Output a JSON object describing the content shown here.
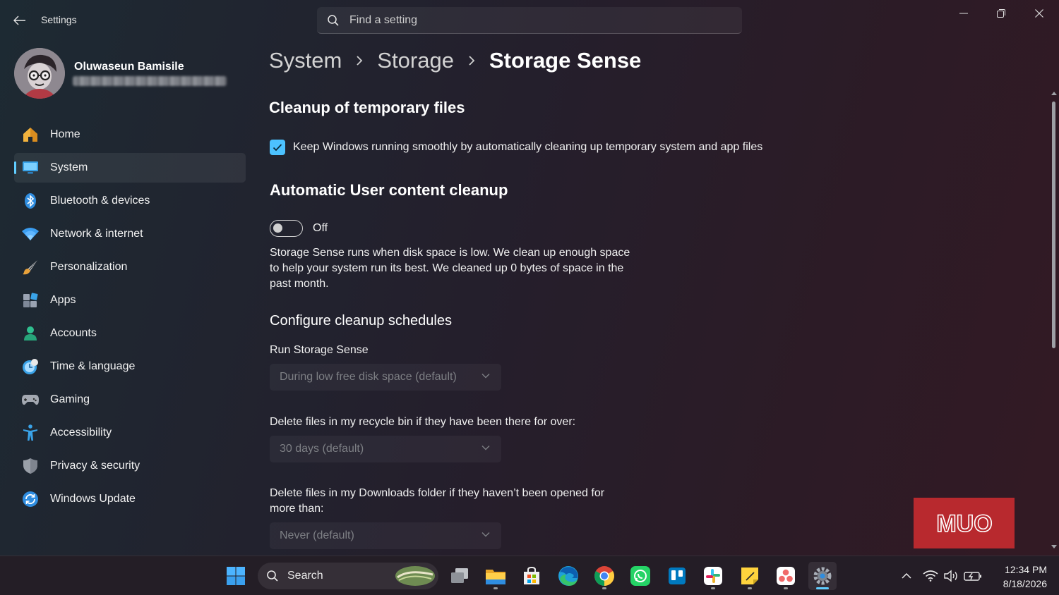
{
  "window": {
    "app_title": "Settings",
    "search_placeholder": "Find a setting"
  },
  "profile": {
    "name": "Oluwaseun Bamisile"
  },
  "nav": {
    "items": [
      {
        "label": "Home",
        "icon": "home-icon"
      },
      {
        "label": "System",
        "icon": "system-icon",
        "active": true
      },
      {
        "label": "Bluetooth & devices",
        "icon": "bluetooth-icon"
      },
      {
        "label": "Network & internet",
        "icon": "wifi-icon"
      },
      {
        "label": "Personalization",
        "icon": "brush-icon"
      },
      {
        "label": "Apps",
        "icon": "apps-icon"
      },
      {
        "label": "Accounts",
        "icon": "accounts-icon"
      },
      {
        "label": "Time & language",
        "icon": "clock-icon"
      },
      {
        "label": "Gaming",
        "icon": "gamepad-icon"
      },
      {
        "label": "Accessibility",
        "icon": "accessibility-icon"
      },
      {
        "label": "Privacy & security",
        "icon": "shield-icon"
      },
      {
        "label": "Windows Update",
        "icon": "update-icon"
      }
    ]
  },
  "breadcrumb": {
    "items": [
      "System",
      "Storage",
      "Storage Sense"
    ]
  },
  "main": {
    "cleanup_heading": "Cleanup of temporary files",
    "cleanup_checkbox_label": "Keep Windows running smoothly by automatically cleaning up temporary system and app files",
    "cleanup_checked": true,
    "auto_heading": "Automatic User content cleanup",
    "toggle_state": "Off",
    "description_lines": [
      "Storage Sense runs when disk space is low. We clean up enough space",
      "to help your system run its best. We cleaned up 0 bytes of space in the",
      "past month."
    ],
    "schedules_heading": "Configure cleanup schedules",
    "run_label": "Run Storage Sense",
    "run_value": "During low free disk space (default)",
    "recycle_label": "Delete files in my recycle bin if they have been there for over:",
    "recycle_value": "30 days (default)",
    "downloads_label_lines": [
      "Delete files in my Downloads folder if they haven’t been opened for",
      "more than:"
    ],
    "downloads_value": "Never (default)"
  },
  "watermark": {
    "text": "MUO"
  },
  "taskbar": {
    "search_label": "Search",
    "apps": [
      "start-icon",
      "task-view-icon",
      "file-explorer-icon",
      "store-icon",
      "edge-icon",
      "chrome-icon",
      "whatsapp-icon",
      "trello-icon",
      "slack-icon",
      "sticky-notes-icon",
      "asana-icon",
      "settings-icon"
    ],
    "time": "12:34 PM",
    "date": "8/18/2026"
  },
  "colors": {
    "accent": "#60cdff",
    "checkbox": "#4cc2ff",
    "watermark_bg": "#b8292e"
  }
}
